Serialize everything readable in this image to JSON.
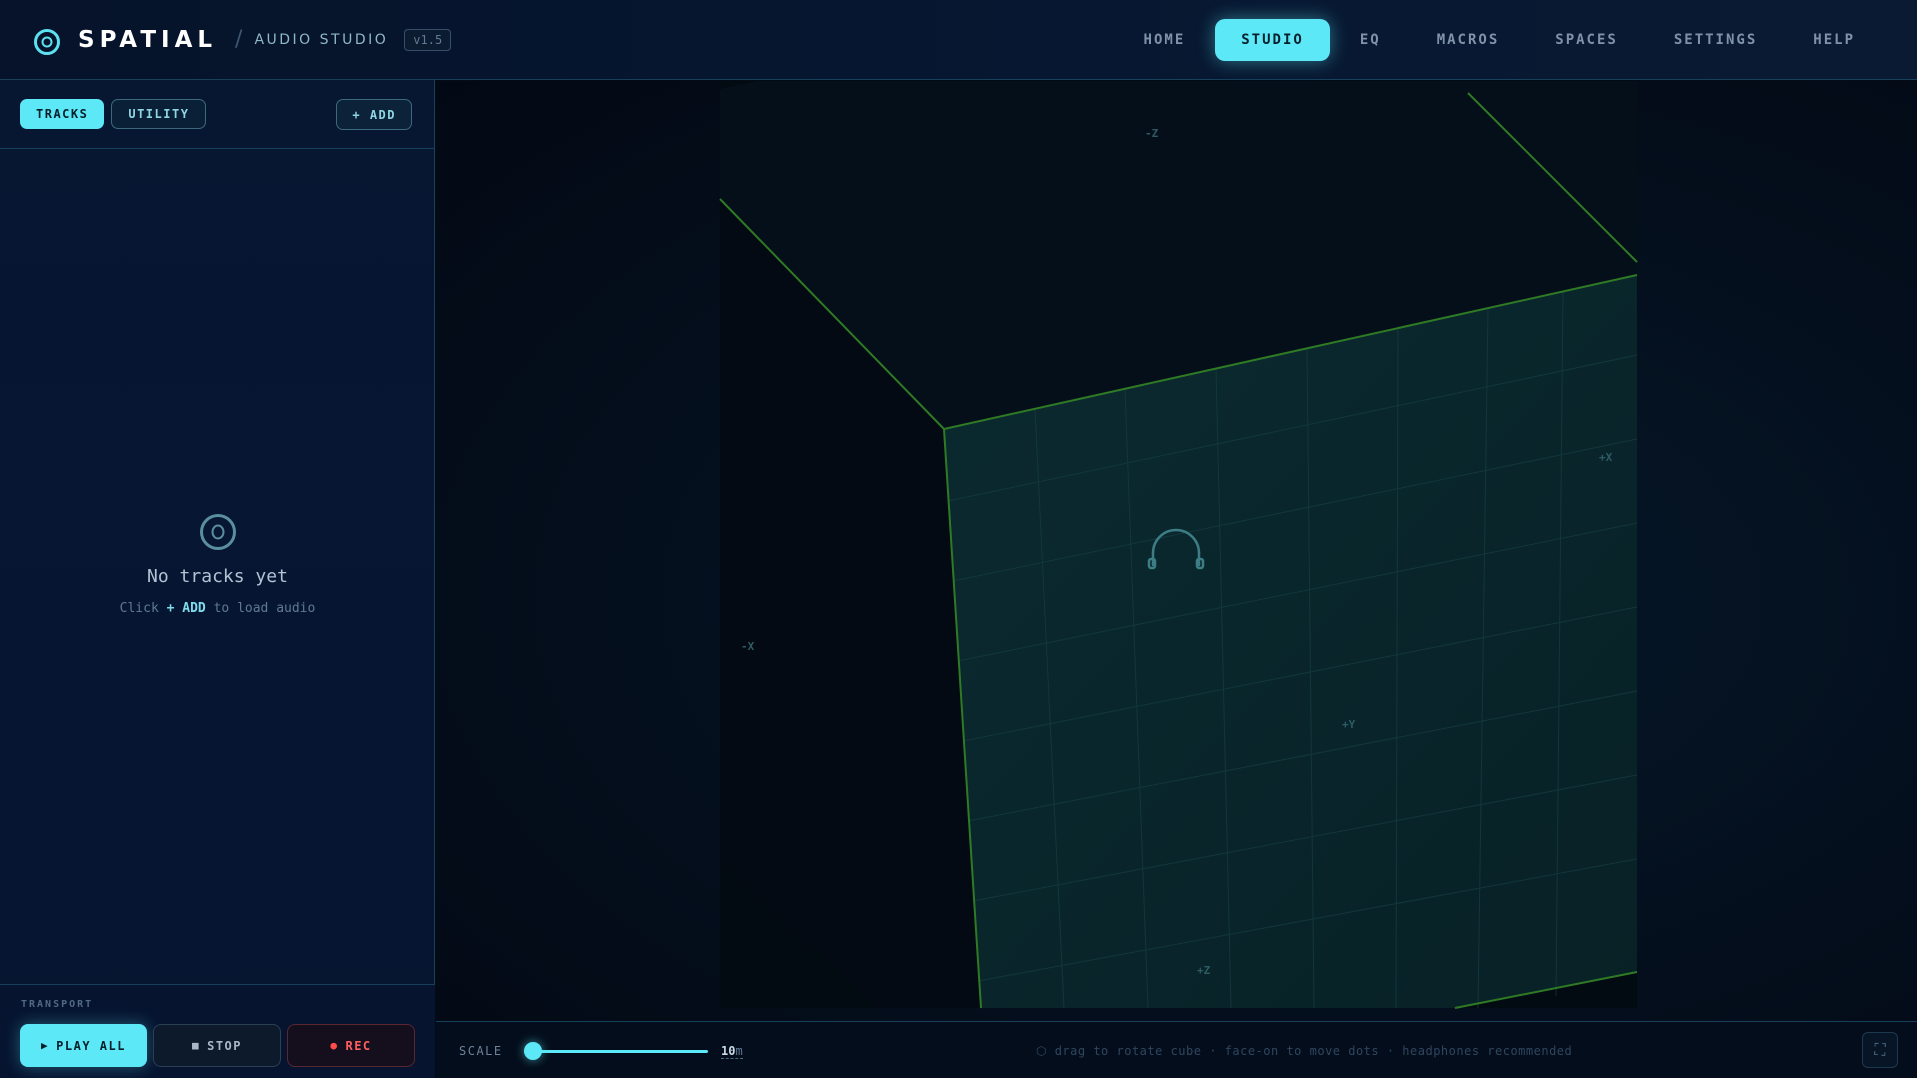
{
  "brand": {
    "name": "SPATIAL",
    "separator": "/",
    "subtitle": "AUDIO STUDIO",
    "version": "v1.5"
  },
  "nav": {
    "items": [
      {
        "label": "HOME"
      },
      {
        "label": "STUDIO"
      },
      {
        "label": "EQ"
      },
      {
        "label": "MACROS"
      },
      {
        "label": "SPACES"
      },
      {
        "label": "SETTINGS"
      },
      {
        "label": "HELP"
      }
    ],
    "active": "STUDIO"
  },
  "sidebar": {
    "tabs": [
      {
        "label": "TRACKS"
      },
      {
        "label": "UTILITY"
      }
    ],
    "add_label": "+ ADD",
    "empty": {
      "title": "No tracks yet",
      "hint_prefix": "Click",
      "hint_action": "+ ADD",
      "hint_suffix": "to load audio"
    },
    "transport": {
      "label": "TRANSPORT",
      "play_label": "PLAY ALL",
      "stop_label": "STOP",
      "rec_label": "REC"
    }
  },
  "viewport": {
    "axis_labels": {
      "neg_z_top": "-Z",
      "neg_x": "-X",
      "pos_x": "+X",
      "pos_y": "+Y",
      "pos_z": "+Z"
    },
    "edge_color": "#2f7a24"
  },
  "bottom": {
    "scale_label": "SCALE",
    "scale_value": "10",
    "scale_unit": "m",
    "scale_fraction": 0.05,
    "hint": "⬡ drag to rotate cube · face-on to move dots · headphones recommended"
  },
  "colors": {
    "accent": "#5ce8f7",
    "record": "#ff4b4b",
    "background": "#030b17"
  },
  "icons": {
    "logo": "target-icon",
    "listener": "headphones-icon",
    "fullscreen": "fullscreen-icon"
  }
}
